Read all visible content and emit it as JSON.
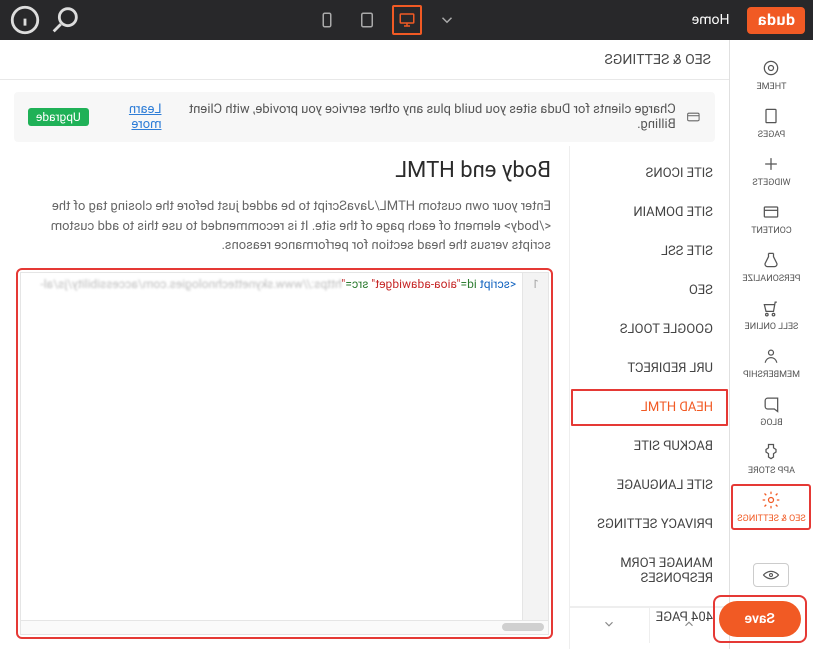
{
  "brand": "duda",
  "top": {
    "home": "Home"
  },
  "sidebar": {
    "items": [
      "THEME",
      "PAGES",
      "WIDGETS",
      "CONTENT",
      "PERSONALIZE",
      "SELL ONLINE",
      "MEMBERSHIP",
      "BLOG",
      "APP STORE",
      "SEO & SETTINGS"
    ],
    "active": 9
  },
  "crumb": "SEO & SETTINGS",
  "banner": {
    "text": "Charge clients for Duda sites you build plus any other service you provide, with Client Billing.",
    "link": "Learn more",
    "badge": "Upgrade"
  },
  "settings": {
    "items": [
      "SITE ICONS",
      "SITE DOMAIN",
      "SITE SSL",
      "SEO",
      "GOOGLE TOOLS",
      "URL REDIRECT",
      "HEAD HTML",
      "BACKUP SITE",
      "SITE LANGUAGE",
      "PRIVACY SETTINGS",
      "MANAGE FORM RESPONSES",
      "404 PAGE"
    ],
    "active": 6
  },
  "content": {
    "title": "Body end HTML",
    "desc": "Enter your own custom HTML/JavaScript to be added just before the closing tag of the </body> element of each page of the site. It is recommended to use this to add custom scripts versus the head section for performance reasons.",
    "code_line_no": "1",
    "code_tag_open": "<script",
    "code_attr_id": " id=",
    "code_val_id": "\"aioa-adawidget\"",
    "code_attr_src": " src=",
    "code_val_quote": "\"",
    "code_blur": "https://www.skynettechnologies.com/accessibility/js/al-"
  },
  "save": "Save"
}
